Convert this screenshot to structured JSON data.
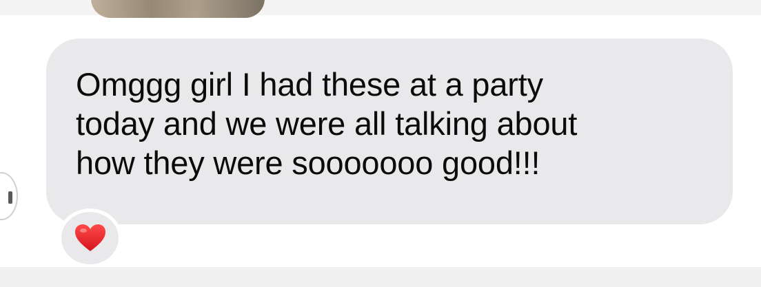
{
  "message": {
    "lines": [
      "Omggg girl I had these at a party",
      "today and we were all talking about",
      "how they were sooooooo good!!!"
    ]
  },
  "reaction": {
    "icon": "red-heart-icon",
    "color": "#e8202a"
  },
  "colors": {
    "bubble": "#e9e9eb",
    "text": "#0b0b0b",
    "background": "#ffffff"
  }
}
